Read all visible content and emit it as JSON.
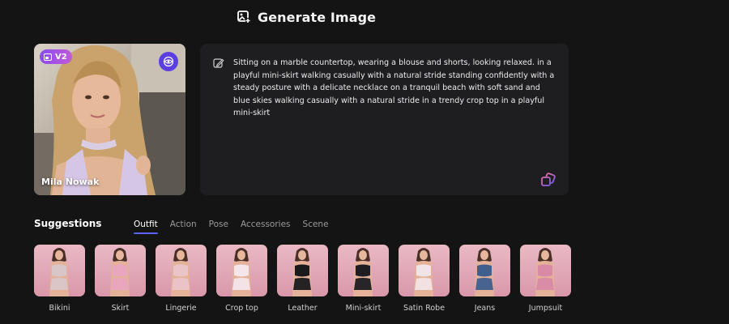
{
  "header": {
    "title": "Generate Image",
    "icon": "image-add-icon"
  },
  "avatar": {
    "badge_label": "V2",
    "name": "Mila Nowak",
    "badge_color": "#8a4bf0",
    "eye_button_color": "#5b3fe0"
  },
  "prompt": {
    "text": "Sitting on a marble countertop, wearing a blouse and shorts, looking relaxed. in a playful mini-skirt walking casually with a natural stride standing confidently with a steady posture with a delicate necklace on a tranquil beach with soft sand and blue skies walking casually with a natural stride in a trendy crop top in a playful mini-skirt"
  },
  "suggestions": {
    "title": "Suggestions",
    "tabs": [
      {
        "label": "Outfit",
        "active": true
      },
      {
        "label": "Action",
        "active": false
      },
      {
        "label": "Pose",
        "active": false
      },
      {
        "label": "Accessories",
        "active": false
      },
      {
        "label": "Scene",
        "active": false
      }
    ],
    "items": [
      {
        "label": "Bikini",
        "outfit_color": "#d9c6c9"
      },
      {
        "label": "Skirt",
        "outfit_color": "#e8a6bf"
      },
      {
        "label": "Lingerie",
        "outfit_color": "#e9c4c8"
      },
      {
        "label": "Crop top",
        "outfit_color": "#f4e6ea"
      },
      {
        "label": "Leather",
        "outfit_color": "#1a1a1c"
      },
      {
        "label": "Mini-skirt",
        "outfit_color": "#1e1e22"
      },
      {
        "label": "Satin Robe",
        "outfit_color": "#f1e4e6"
      },
      {
        "label": "Jeans",
        "outfit_color": "#3f5f8e"
      },
      {
        "label": "Jumpsuit",
        "outfit_color": "#d88aa6"
      }
    ],
    "accent_color": "#5b63f0"
  }
}
